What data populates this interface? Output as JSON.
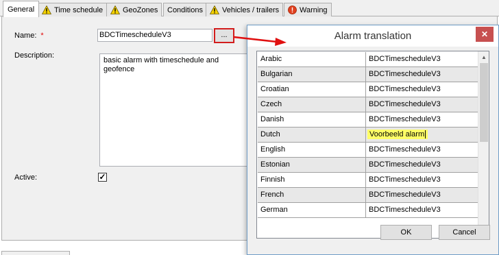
{
  "tabs": [
    {
      "label": "General",
      "icon": null
    },
    {
      "label": "Time schedule",
      "icon": "warning-icon"
    },
    {
      "label": "GeoZones",
      "icon": "warning-icon"
    },
    {
      "label": "Conditions",
      "icon": null
    },
    {
      "label": "Vehicles / trailers",
      "icon": "warning-icon"
    },
    {
      "label": "Warning",
      "icon": "error-icon"
    }
  ],
  "form": {
    "name_label": "Name:",
    "required_mark": "*",
    "name_value": "BDCTimescheduleV3",
    "ellipsis_label": "...",
    "description_label": "Description:",
    "description_value": "basic alarm with timeschedule and geofence",
    "active_label": "Active:",
    "active_checked": true,
    "checkmark": "✓"
  },
  "dialog": {
    "title": "Alarm translation",
    "close_label": "✕",
    "rows": [
      {
        "language": "Arabic",
        "value": "BDCTimescheduleV3"
      },
      {
        "language": "Bulgarian",
        "value": "BDCTimescheduleV3"
      },
      {
        "language": "Croatian",
        "value": "BDCTimescheduleV3"
      },
      {
        "language": "Czech",
        "value": "BDCTimescheduleV3"
      },
      {
        "language": "Danish",
        "value": "BDCTimescheduleV3"
      },
      {
        "language": "Dutch",
        "value": "Voorbeeld alarm"
      },
      {
        "language": "English",
        "value": "BDCTimescheduleV3"
      },
      {
        "language": "Estonian",
        "value": "BDCTimescheduleV3"
      },
      {
        "language": "Finnish",
        "value": "BDCTimescheduleV3"
      },
      {
        "language": "French",
        "value": "BDCTimescheduleV3"
      },
      {
        "language": "German",
        "value": "BDCTimescheduleV3"
      }
    ],
    "editing_row_index": 5,
    "ok_label": "OK",
    "cancel_label": "Cancel"
  },
  "colors": {
    "highlight_border": "#d21c1c",
    "arrow": "#e01010",
    "edit_highlight": "#ffff66",
    "warning_yellow": "#f5d200",
    "error_red": "#e04020"
  }
}
